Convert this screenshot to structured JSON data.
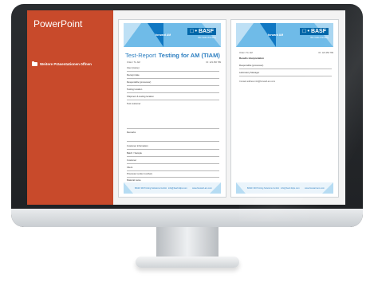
{
  "app": {
    "title": "PowerPoint"
  },
  "sidebar": {
    "item_label": "Weitere Präsentationen öffnen"
  },
  "page1": {
    "title": "Test-Report",
    "subtitle": "Testing for AM (TIAM)",
    "meta_left": "Order / To: AM",
    "meta_right": "ID: 123 456 789",
    "fields": [
      "User (name)",
      "Receipt date",
      "Responsible (processor)",
      "Testing location",
      "Shipment & testing location",
      "Test customer",
      "Remarks",
      "Customer information",
      "Batch / Sample",
      "Customer",
      "Client",
      "Processor (order number)",
      "Material name",
      "Sample form"
    ],
    "footer": {
      "left": "BASF 3D Printing Solutions GmbH",
      "mid": "info@basf-3dps.com",
      "right": "www.forward-am.com"
    }
  },
  "page2": {
    "meta_left": "Order / To: AM",
    "meta_right": "ID: 123 456 789",
    "title": "Results interpretation",
    "fields": [
      "Responsible (processor)",
      "Laboratory Manager"
    ],
    "contact": "Contact address   info@forward-am.com",
    "footer": {
      "left": "BASF 3D Printing Solutions GmbH",
      "mid": "info@basf-3dps.com",
      "right": "www.forward-am.com"
    }
  },
  "brand": {
    "left_logo": "forward AM",
    "basf": "□ • BASF",
    "basf_sub": "We create chemistry"
  },
  "colors": {
    "sidebar": "#c84a2b",
    "header_blue": "#6fbbe8",
    "title_blue": "#2d7fc1"
  }
}
